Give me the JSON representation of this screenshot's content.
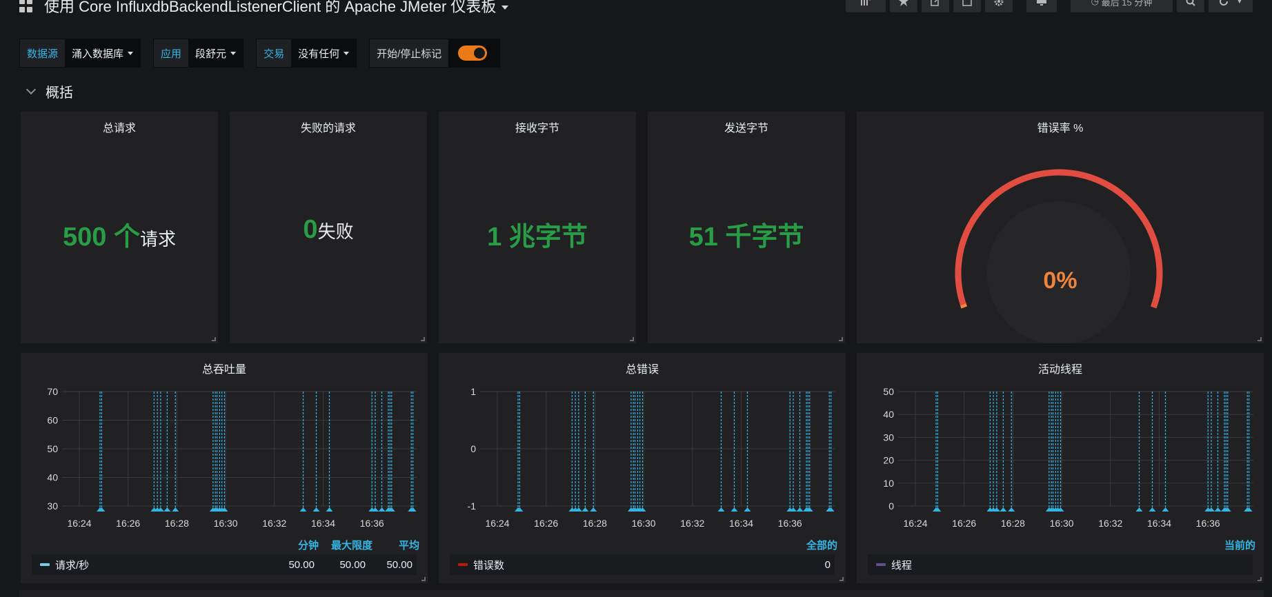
{
  "header": {
    "title": "使用 Core InfluxdbBackendListenerClient 的 Apache JMeter 仪表板",
    "time_range": "最后 15 分钟"
  },
  "variables": [
    {
      "label": "数据源",
      "value": "涌入数据库"
    },
    {
      "label": "应用",
      "value": "段舒元"
    },
    {
      "label": "交易",
      "value": "没有任何"
    }
  ],
  "annotation_toggle": {
    "label": "开始/停止标记",
    "enabled": true
  },
  "row": {
    "title": "概括"
  },
  "stats": {
    "total_requests": {
      "title": "总请求",
      "value": "500 个",
      "unit": "请求"
    },
    "failed_requests": {
      "title": "失败的请求",
      "value": "0",
      "unit": "失败"
    },
    "bytes_received": {
      "title": "接收字节",
      "value": "1 兆字节"
    },
    "bytes_sent": {
      "title": "发送字节",
      "value": "51 千字节"
    },
    "error_rate": {
      "title": "错误率 %",
      "value": "0%",
      "gauge_fraction": 0
    }
  },
  "time_labels": [
    "16:24",
    "16:26",
    "16:28",
    "16:30",
    "16:32",
    "16:34",
    "16:36"
  ],
  "graphs": {
    "throughput": {
      "title": "总吞吐量",
      "yticks": [
        "70",
        "60",
        "50",
        "40",
        "30"
      ],
      "legend_headers": [
        "分钟",
        "最大限度",
        "平均"
      ],
      "legend": {
        "name": "请求/秒",
        "color": "#6ed0e0",
        "values": [
          "50.00",
          "50.00",
          "50.00"
        ]
      }
    },
    "errors": {
      "title": "总错误",
      "yticks": [
        "1",
        "0",
        "-1"
      ],
      "legend_headers": [
        "全部的"
      ],
      "legend": {
        "name": "错误数",
        "color": "#bf1b00",
        "values": [
          "0"
        ]
      }
    },
    "threads": {
      "title": "活动线程",
      "yticks": [
        "50",
        "40",
        "30",
        "20",
        "10",
        "0"
      ],
      "legend_headers": [
        "当前的"
      ],
      "legend": {
        "name": "线程",
        "color": "#614d93",
        "values": [
          ""
        ]
      }
    }
  },
  "colors": {
    "accent": "#33b5e5",
    "ok": "#299c46",
    "warn": "#ef843c",
    "gauge": "#e24d42"
  }
}
